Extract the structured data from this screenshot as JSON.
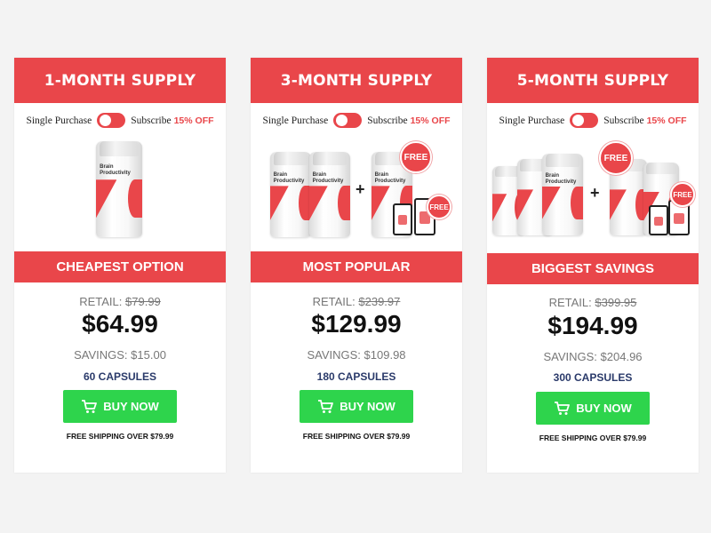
{
  "colors": {
    "brand_red": "#e9464a",
    "buy_green": "#2ed44c",
    "capsule_navy": "#2a3a6a"
  },
  "plans": [
    {
      "title": "1-MONTH SUPPLY",
      "single_label": "Single Purchase",
      "subscribe_label": "Subscribe",
      "discount": "15% OFF",
      "banner": "CHEAPEST OPTION",
      "retail_label": "RETAIL:",
      "retail_price": "$79.99",
      "price": "$64.99",
      "savings_label": "SAVINGS:",
      "savings": "$15.00",
      "capsules": "60 CAPSULES",
      "buy_label": "BUY NOW",
      "shipping": "FREE SHIPPING OVER $79.99",
      "bottle_text": "Brain Productivity"
    },
    {
      "title": "3-MONTH SUPPLY",
      "single_label": "Single Purchase",
      "subscribe_label": "Subscribe",
      "discount": "15% OFF",
      "banner": "MOST POPULAR",
      "retail_label": "RETAIL:",
      "retail_price": "$239.97",
      "price": "$129.99",
      "savings_label": "SAVINGS:",
      "savings": "$109.98",
      "capsules": "180 CAPSULES",
      "buy_label": "BUY NOW",
      "shipping": "FREE SHIPPING OVER $79.99",
      "bottle_text": "Brain Productivity",
      "free_badge": "FREE",
      "plus": "+"
    },
    {
      "title": "5-MONTH SUPPLY",
      "single_label": "Single Purchase",
      "subscribe_label": "Subscribe",
      "discount": "15% OFF",
      "banner": "BIGGEST SAVINGS",
      "retail_label": "RETAIL:",
      "retail_price": "$399.95",
      "price": "$194.99",
      "savings_label": "SAVINGS:",
      "savings": "$204.96",
      "capsules": "300 CAPSULES",
      "buy_label": "BUY NOW",
      "shipping": "FREE SHIPPING OVER $79.99",
      "bottle_text": "Brain Productivity",
      "free_badge": "FREE",
      "plus": "+"
    }
  ]
}
